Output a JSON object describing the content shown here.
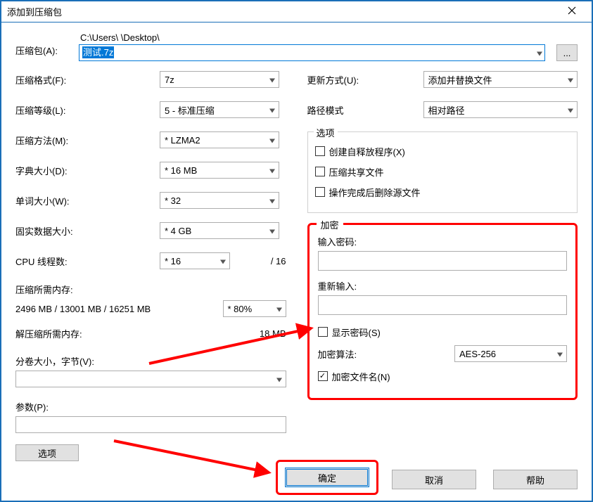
{
  "window": {
    "title": "添加到压缩包"
  },
  "path": {
    "label": "压缩包(A):",
    "dir": "C:\\Users\\          \\Desktop\\",
    "file": "测试.7z"
  },
  "left": {
    "format_label": "压缩格式(F):",
    "format_value": "7z",
    "level_label": "压缩等级(L):",
    "level_value": "5 - 标准压缩",
    "method_label": "压缩方法(M):",
    "method_value": "* LZMA2",
    "dict_label": "字典大小(D):",
    "dict_value": "* 16 MB",
    "word_label": "单词大小(W):",
    "word_value": "* 32",
    "solid_label": "固实数据大小:",
    "solid_value": "* 4 GB",
    "threads_label": "CPU 线程数:",
    "threads_value": "* 16",
    "threads_max": "/ 16",
    "mem_comp_label": "压缩所需内存:",
    "mem_comp_values": "2496 MB / 13001 MB / 16251 MB",
    "mem_percent": "* 80%",
    "mem_decomp_label": "解压缩所需内存:",
    "mem_decomp_value": "18 MB",
    "volume_label": "分卷大小，字节(V):",
    "param_label": "参数(P):",
    "option_btn": "选项"
  },
  "right": {
    "update_label": "更新方式(U):",
    "update_value": "添加并替换文件",
    "pathmode_label": "路径模式",
    "pathmode_value": "相对路径",
    "opts_legend": "选项",
    "sfx_label": "创建自释放程序(X)",
    "share_label": "压缩共享文件",
    "delete_label": "操作完成后删除源文件"
  },
  "enc": {
    "legend": "加密",
    "pwd_label": "输入密码:",
    "pwd2_label": "重新输入:",
    "show_label": "显示密码(S)",
    "method_label": "加密算法:",
    "method_value": "AES-256",
    "names_label": "加密文件名(N)"
  },
  "buttons": {
    "ok": "确定",
    "cancel": "取消",
    "help": "帮助"
  }
}
